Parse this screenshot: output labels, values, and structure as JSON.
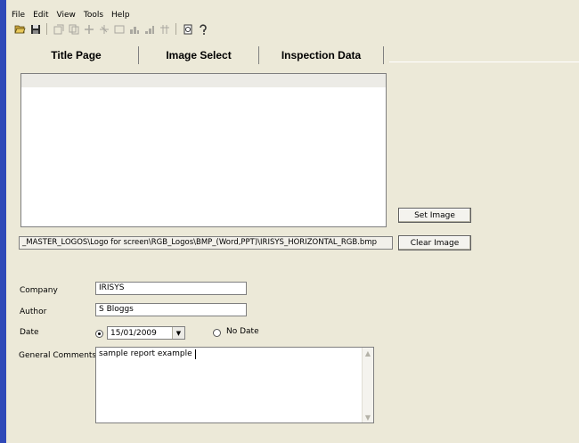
{
  "menu": {
    "items": [
      "File",
      "Edit",
      "View",
      "Tools",
      "Help"
    ]
  },
  "toolbar": {
    "icons": [
      "open-folder-icon",
      "save-icon",
      "properties-icon",
      "copy-icon",
      "add-icon",
      "insert-icon",
      "rectangle-icon",
      "chart-icon",
      "chart-alt-icon",
      "table-icon",
      "print-preview-icon",
      "help-icon"
    ]
  },
  "tabs": [
    "Title Page",
    "Image Select",
    "Inspection Data"
  ],
  "image": {
    "path": "_MASTER_LOGOS\\Logo for screen\\RGB_Logos\\BMP_(Word,PPT)\\IRISYS_HORIZONTAL_RGB.bmp"
  },
  "buttons": {
    "set_image": "Set Image",
    "clear_image": "Clear Image"
  },
  "form": {
    "company_label": "Company",
    "company_value": "IRISYS",
    "author_label": "Author",
    "author_value": "S Bloggs",
    "date_label": "Date",
    "date_value": "15/01/2009",
    "no_date_label": "No Date",
    "comments_label": "General Comments",
    "comments_value": "sample report example"
  },
  "colors": {
    "window_bg": "#ece9d8",
    "left_edge": "#2f49b8"
  }
}
